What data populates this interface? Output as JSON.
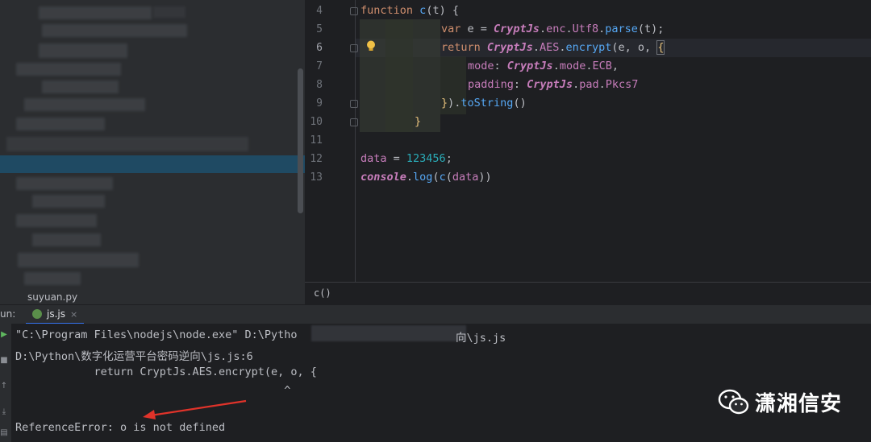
{
  "project_panel": {
    "visible_file": "suyuan.py"
  },
  "editor": {
    "line_numbers": [
      "4",
      "5",
      "6",
      "7",
      "8",
      "9",
      "10",
      "11",
      "12",
      "13"
    ],
    "current_line": "6",
    "lines": [
      [
        "function",
        " ",
        "c",
        "(t) {"
      ],
      [
        "var",
        " e = ",
        "CryptJs",
        ".",
        "enc",
        ".",
        "Utf8",
        ".",
        "parse",
        "(t);"
      ],
      [
        "return",
        " ",
        "CryptJs",
        ".",
        "AES",
        ".",
        "encrypt",
        "(e, o, ",
        "{"
      ],
      [
        "mode",
        ": ",
        "CryptJs",
        ".",
        "mode",
        ".",
        "ECB",
        ","
      ],
      [
        "padding",
        ": ",
        "CryptJs",
        ".",
        "pad",
        ".",
        "Pkcs7"
      ],
      [
        "}",
        ").",
        "toString",
        "()"
      ],
      [
        "}"
      ],
      [
        ""
      ],
      [
        "data",
        " = ",
        "123456",
        ";"
      ],
      [
        "console",
        ".",
        "log",
        "(",
        "c",
        "(",
        "data",
        "))"
      ]
    ],
    "breadcrumb": "c()"
  },
  "run_window": {
    "label": "un:",
    "tab_label": "js.js",
    "tab_close": "×",
    "output": [
      "\"C:\\Program Files\\nodejs\\node.exe\" D:\\Pytho",
      "向\\js.js",
      "D:\\Python\\数字化运营平台密码逆向\\js.js:6",
      "            return CryptJs.AES.encrypt(e, o, {",
      "                                         ^",
      "",
      "ReferenceError: o is not defined"
    ]
  },
  "watermark": {
    "text": "潇湘信安"
  },
  "colors": {
    "keyword": "#cf8e6d",
    "function": "#56a8f5",
    "object": "#c77dbb",
    "number": "#2aacb8",
    "error_arrow": "#e0332a"
  }
}
